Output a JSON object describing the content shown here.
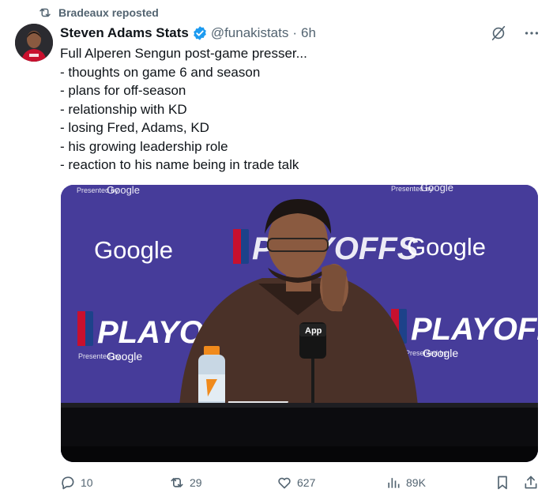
{
  "repost": {
    "label": "Bradeaux reposted",
    "icon": "repost-icon"
  },
  "author": {
    "name": "Steven Adams Stats",
    "handle": "@funakistats",
    "separator": "·",
    "time": "6h",
    "verified": true,
    "verified_color": "#1d9bf0"
  },
  "tweet": {
    "lines": [
      "Full Alperen Sengun post-game presser...",
      "- thoughts on game 6 and season",
      "- plans for off-season",
      "- relationship with KD",
      "- losing Fred, Adams, KD",
      "- his growing leadership role",
      "- reaction to his name being in trade talk"
    ]
  },
  "media": {
    "backdrop_texts": {
      "presented_by": "Presented by",
      "google": "Google",
      "playoffs": "PLAYOFFS",
      "mic_tag": "App"
    },
    "backdrop_color": "#4a3f9a"
  },
  "actions": {
    "replies": "10",
    "reposts": "29",
    "likes": "627",
    "views": "89K"
  },
  "colors": {
    "text": "#0f1419",
    "muted": "#536471",
    "accent": "#1d9bf0"
  }
}
